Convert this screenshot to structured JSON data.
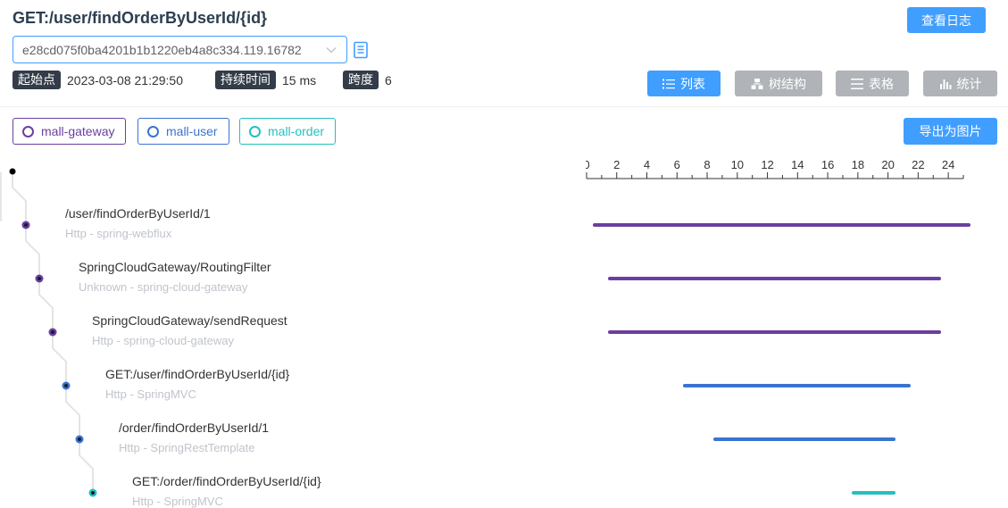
{
  "header": {
    "title": "GET:/user/findOrderByUserId/{id}",
    "log_button": "查看日志",
    "trace_id": "e28cd075f0ba4201b1b1220eb4a8c334.119.16782"
  },
  "meta": {
    "start_label": "起始点",
    "start_value": "2023-03-08 21:29:50",
    "duration_label": "持续时间",
    "duration_value": "15 ms",
    "span_label": "跨度",
    "span_value": "6"
  },
  "view_buttons": {
    "list": "列表",
    "tree": "树结构",
    "table": "表格",
    "stats": "统计"
  },
  "services": [
    {
      "name": "mall-gateway",
      "color": "#6a3fa0"
    },
    {
      "name": "mall-user",
      "color": "#3b73d1"
    },
    {
      "name": "mall-order",
      "color": "#26bfbf"
    }
  ],
  "export_button": "导出为图片",
  "axis": {
    "ticks": [
      "0",
      "2",
      "4",
      "6",
      "8",
      "10",
      "12",
      "14",
      "16",
      "18",
      "20",
      "22",
      "24"
    ],
    "max": 25
  },
  "spans": [
    {
      "name": "/user/findOrderByUserId/1",
      "sub": "Http - spring-webflux",
      "service": 0,
      "start": 0.4,
      "end": 25.5
    },
    {
      "name": "SpringCloudGateway/RoutingFilter",
      "sub": "Unknown - spring-cloud-gateway",
      "service": 0,
      "start": 1.4,
      "end": 23.5
    },
    {
      "name": "SpringCloudGateway/sendRequest",
      "sub": "Http - spring-cloud-gateway",
      "service": 0,
      "start": 1.4,
      "end": 23.5
    },
    {
      "name": "GET:/user/findOrderByUserId/{id}",
      "sub": "Http - SpringMVC",
      "service": 1,
      "start": 6.4,
      "end": 21.5
    },
    {
      "name": "/order/findOrderByUserId/1",
      "sub": "Http - SpringRestTemplate",
      "service": 1,
      "start": 8.4,
      "end": 20.5
    },
    {
      "name": "GET:/order/findOrderByUserId/{id}",
      "sub": "Http - SpringMVC",
      "service": 2,
      "start": 17.6,
      "end": 20.5
    }
  ]
}
